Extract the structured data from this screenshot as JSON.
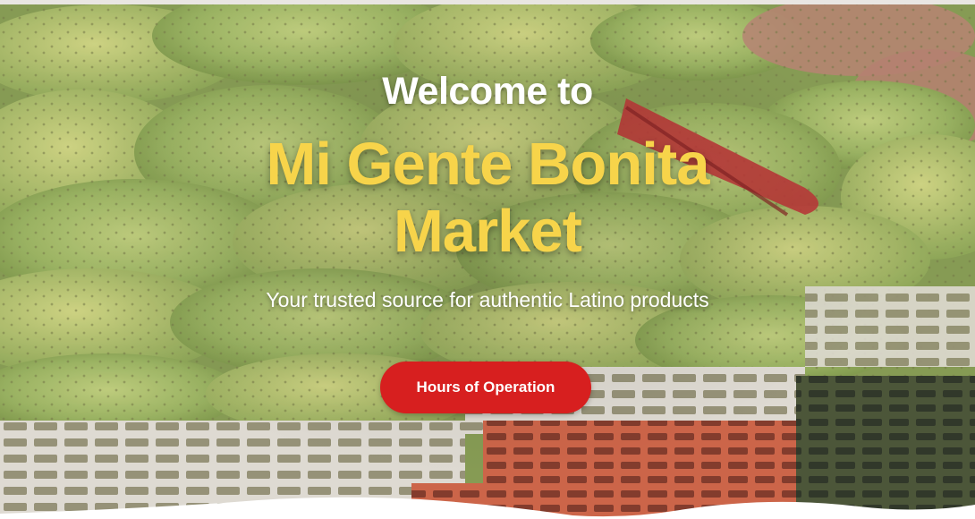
{
  "hero": {
    "welcome_text": "Welcome to",
    "market_name_line1": "Mi Gente Bonita",
    "market_name_line2": "Market",
    "tagline": "Your trusted source for authentic Latino products",
    "hours_button_label": "Hours of Operation",
    "background_image": "nopal-cactus-paddles-in-crates"
  },
  "colors": {
    "accent_yellow": "#f7d44a",
    "button_red": "#d71f1f",
    "text_white": "#ffffff"
  }
}
